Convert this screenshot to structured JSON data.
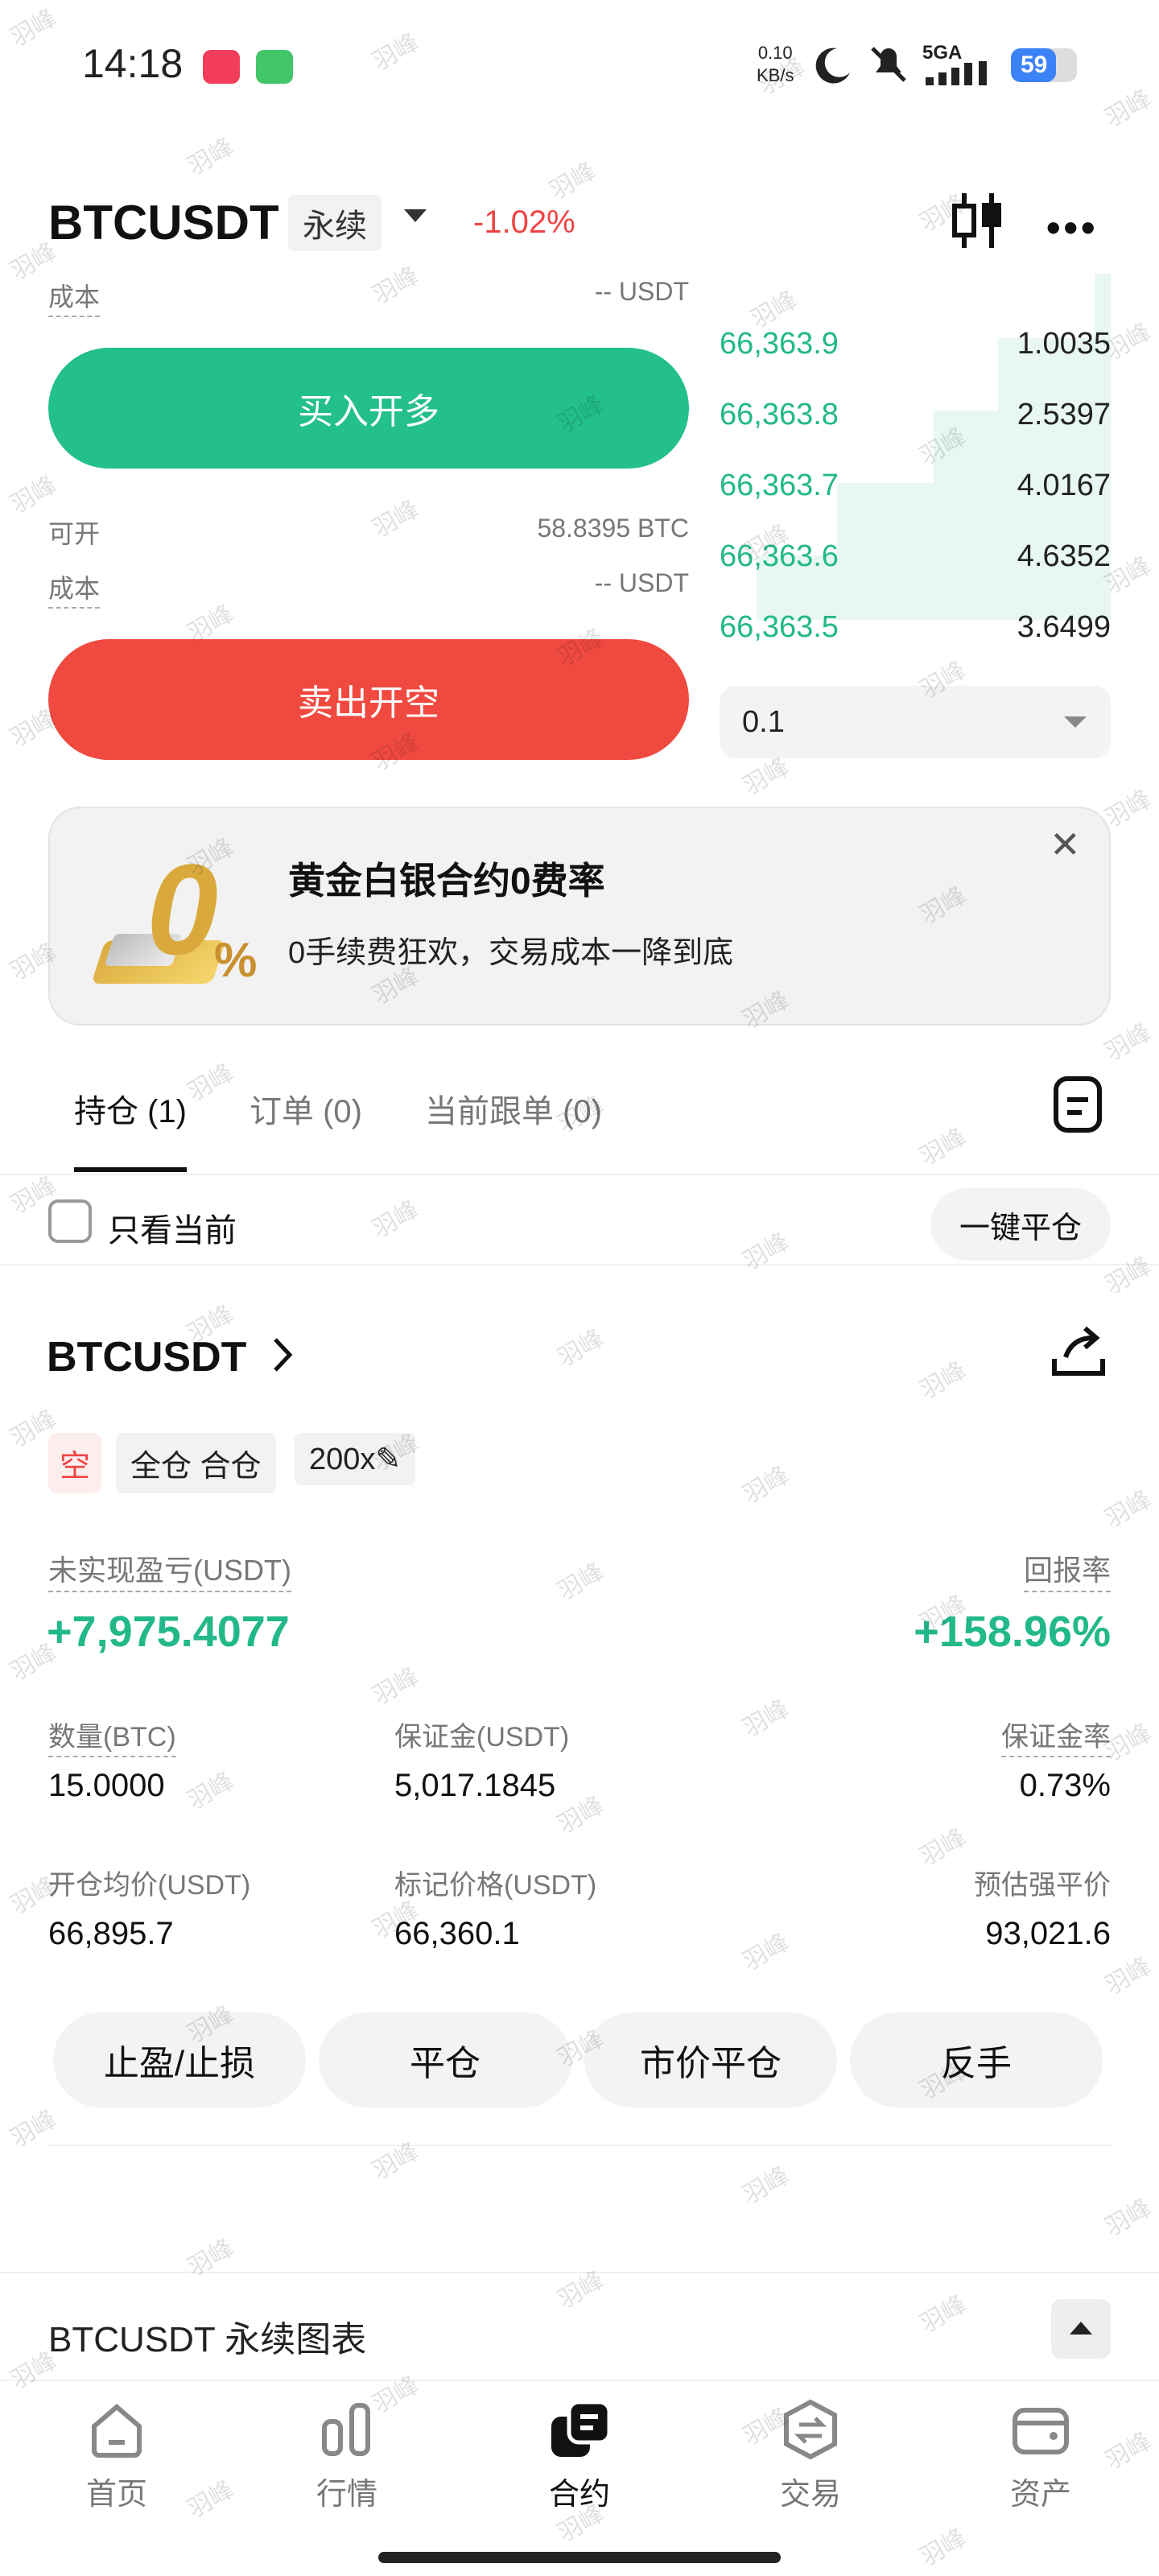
{
  "status_bar": {
    "time": "14:18",
    "net_speed_top": "0.10",
    "net_speed_bottom": "KB/s",
    "network": "5GA",
    "battery": "59"
  },
  "header": {
    "symbol": "BTCUSDT",
    "contract_type": "永续",
    "change": "-1.02%"
  },
  "order_form": {
    "cost_label": "成本",
    "cost_value": "-- USDT",
    "buy_button": "买入开多",
    "available_label": "可开",
    "available_value": "58.8395 BTC",
    "cost_label_2": "成本",
    "cost_value_2": "-- USDT",
    "sell_button": "卖出开空"
  },
  "order_book": {
    "rows": [
      {
        "price": "66,363.9",
        "qty": "1.0035"
      },
      {
        "price": "66,363.8",
        "qty": "2.5397"
      },
      {
        "price": "66,363.7",
        "qty": "4.0167"
      },
      {
        "price": "66,363.6",
        "qty": "4.6352"
      },
      {
        "price": "66,363.5",
        "qty": "3.6499"
      }
    ],
    "depth_select": "0.1"
  },
  "promo": {
    "title": "黄金白银合约0费率",
    "subtitle": "0手续费狂欢，交易成本一降到底"
  },
  "tabs": [
    {
      "label": "持仓 (1)"
    },
    {
      "label": "订单 (0)"
    },
    {
      "label": "当前跟单 (0)"
    }
  ],
  "filter": {
    "only_current": "只看当前",
    "close_all": "一键平仓"
  },
  "position": {
    "symbol": "BTCUSDT",
    "side": "空",
    "margin_mode": "全仓 合仓",
    "leverage": "200x",
    "unrealized_pnl_label": "未实现盈亏(USDT)",
    "unrealized_pnl": "+7,975.4077",
    "roe_label": "回报率",
    "roe": "+158.96%",
    "qty_label": "数量(BTC)",
    "qty": "15.0000",
    "margin_label": "保证金(USDT)",
    "margin": "5,017.1845",
    "margin_ratio_label": "保证金率",
    "margin_ratio": "0.73%",
    "entry_label": "开仓均价(USDT)",
    "entry": "66,895.7",
    "mark_label": "标记价格(USDT)",
    "mark": "66,360.1",
    "liq_label": "预估强平价",
    "liq": "93,021.6",
    "actions": [
      "止盈/止损",
      "平仓",
      "市价平仓",
      "反手"
    ]
  },
  "chart_section": {
    "title": "BTCUSDT 永续图表"
  },
  "bottom_nav": [
    {
      "label": "首页"
    },
    {
      "label": "行情"
    },
    {
      "label": "合约"
    },
    {
      "label": "交易"
    },
    {
      "label": "资产"
    }
  ],
  "watermark": "羽峰",
  "colors": {
    "green": "#23b88a",
    "red": "#ef4444"
  }
}
